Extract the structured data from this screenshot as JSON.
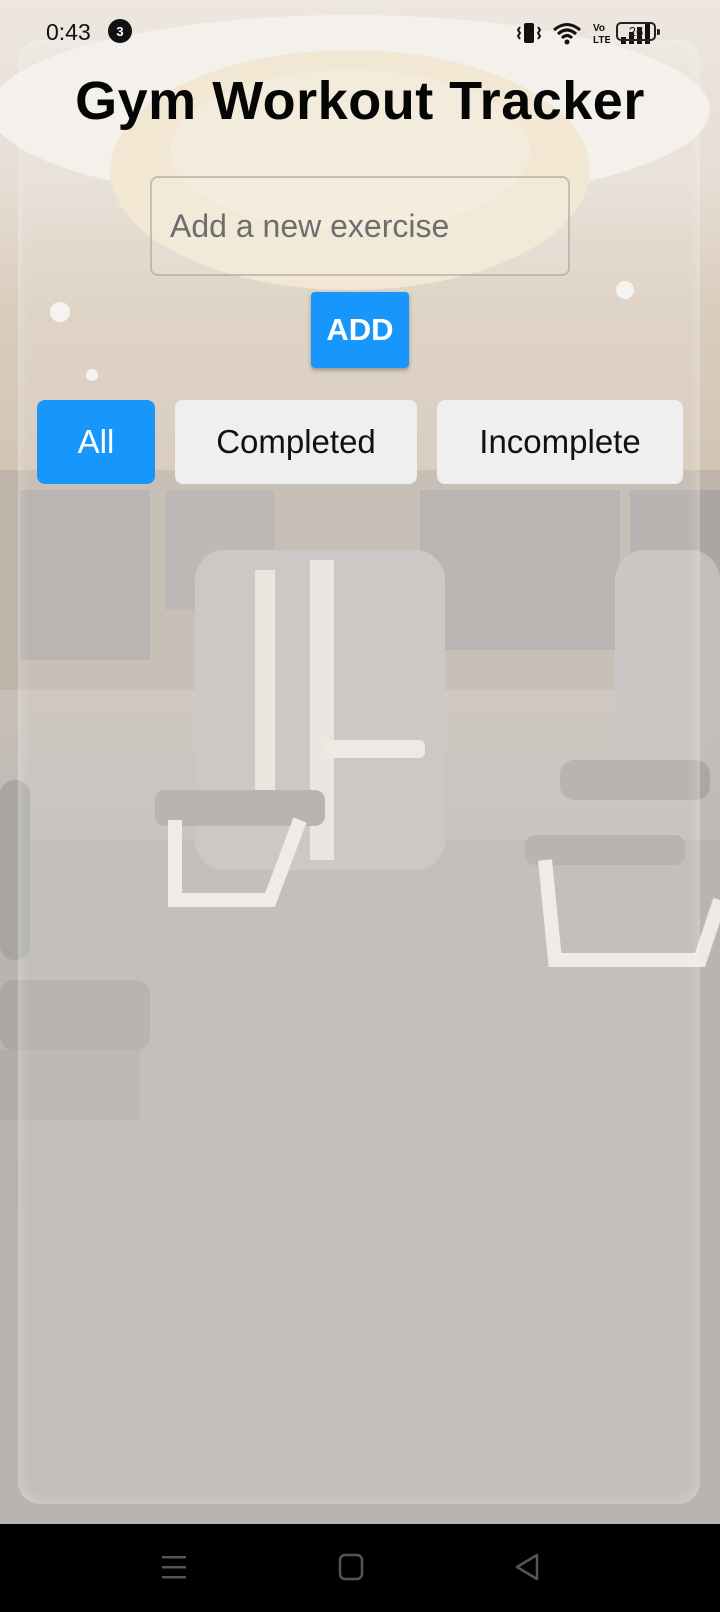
{
  "status_bar": {
    "time": "0:43",
    "notification_count": "3",
    "battery_level": "26",
    "icons": [
      "vibrate-icon",
      "wifi-icon",
      "volte-icon",
      "signal-icon",
      "battery-icon"
    ]
  },
  "app": {
    "title": "Gym Workout Tracker",
    "input_placeholder": "Add a new exercise",
    "input_value": "",
    "add_label": "ADD",
    "filters": [
      "All",
      "Completed",
      "Incomplete"
    ],
    "active_filter": "All",
    "accent_color": "#1797fb"
  },
  "nav_bar": {
    "icons": [
      "menu-icon",
      "home-icon",
      "back-icon"
    ]
  }
}
